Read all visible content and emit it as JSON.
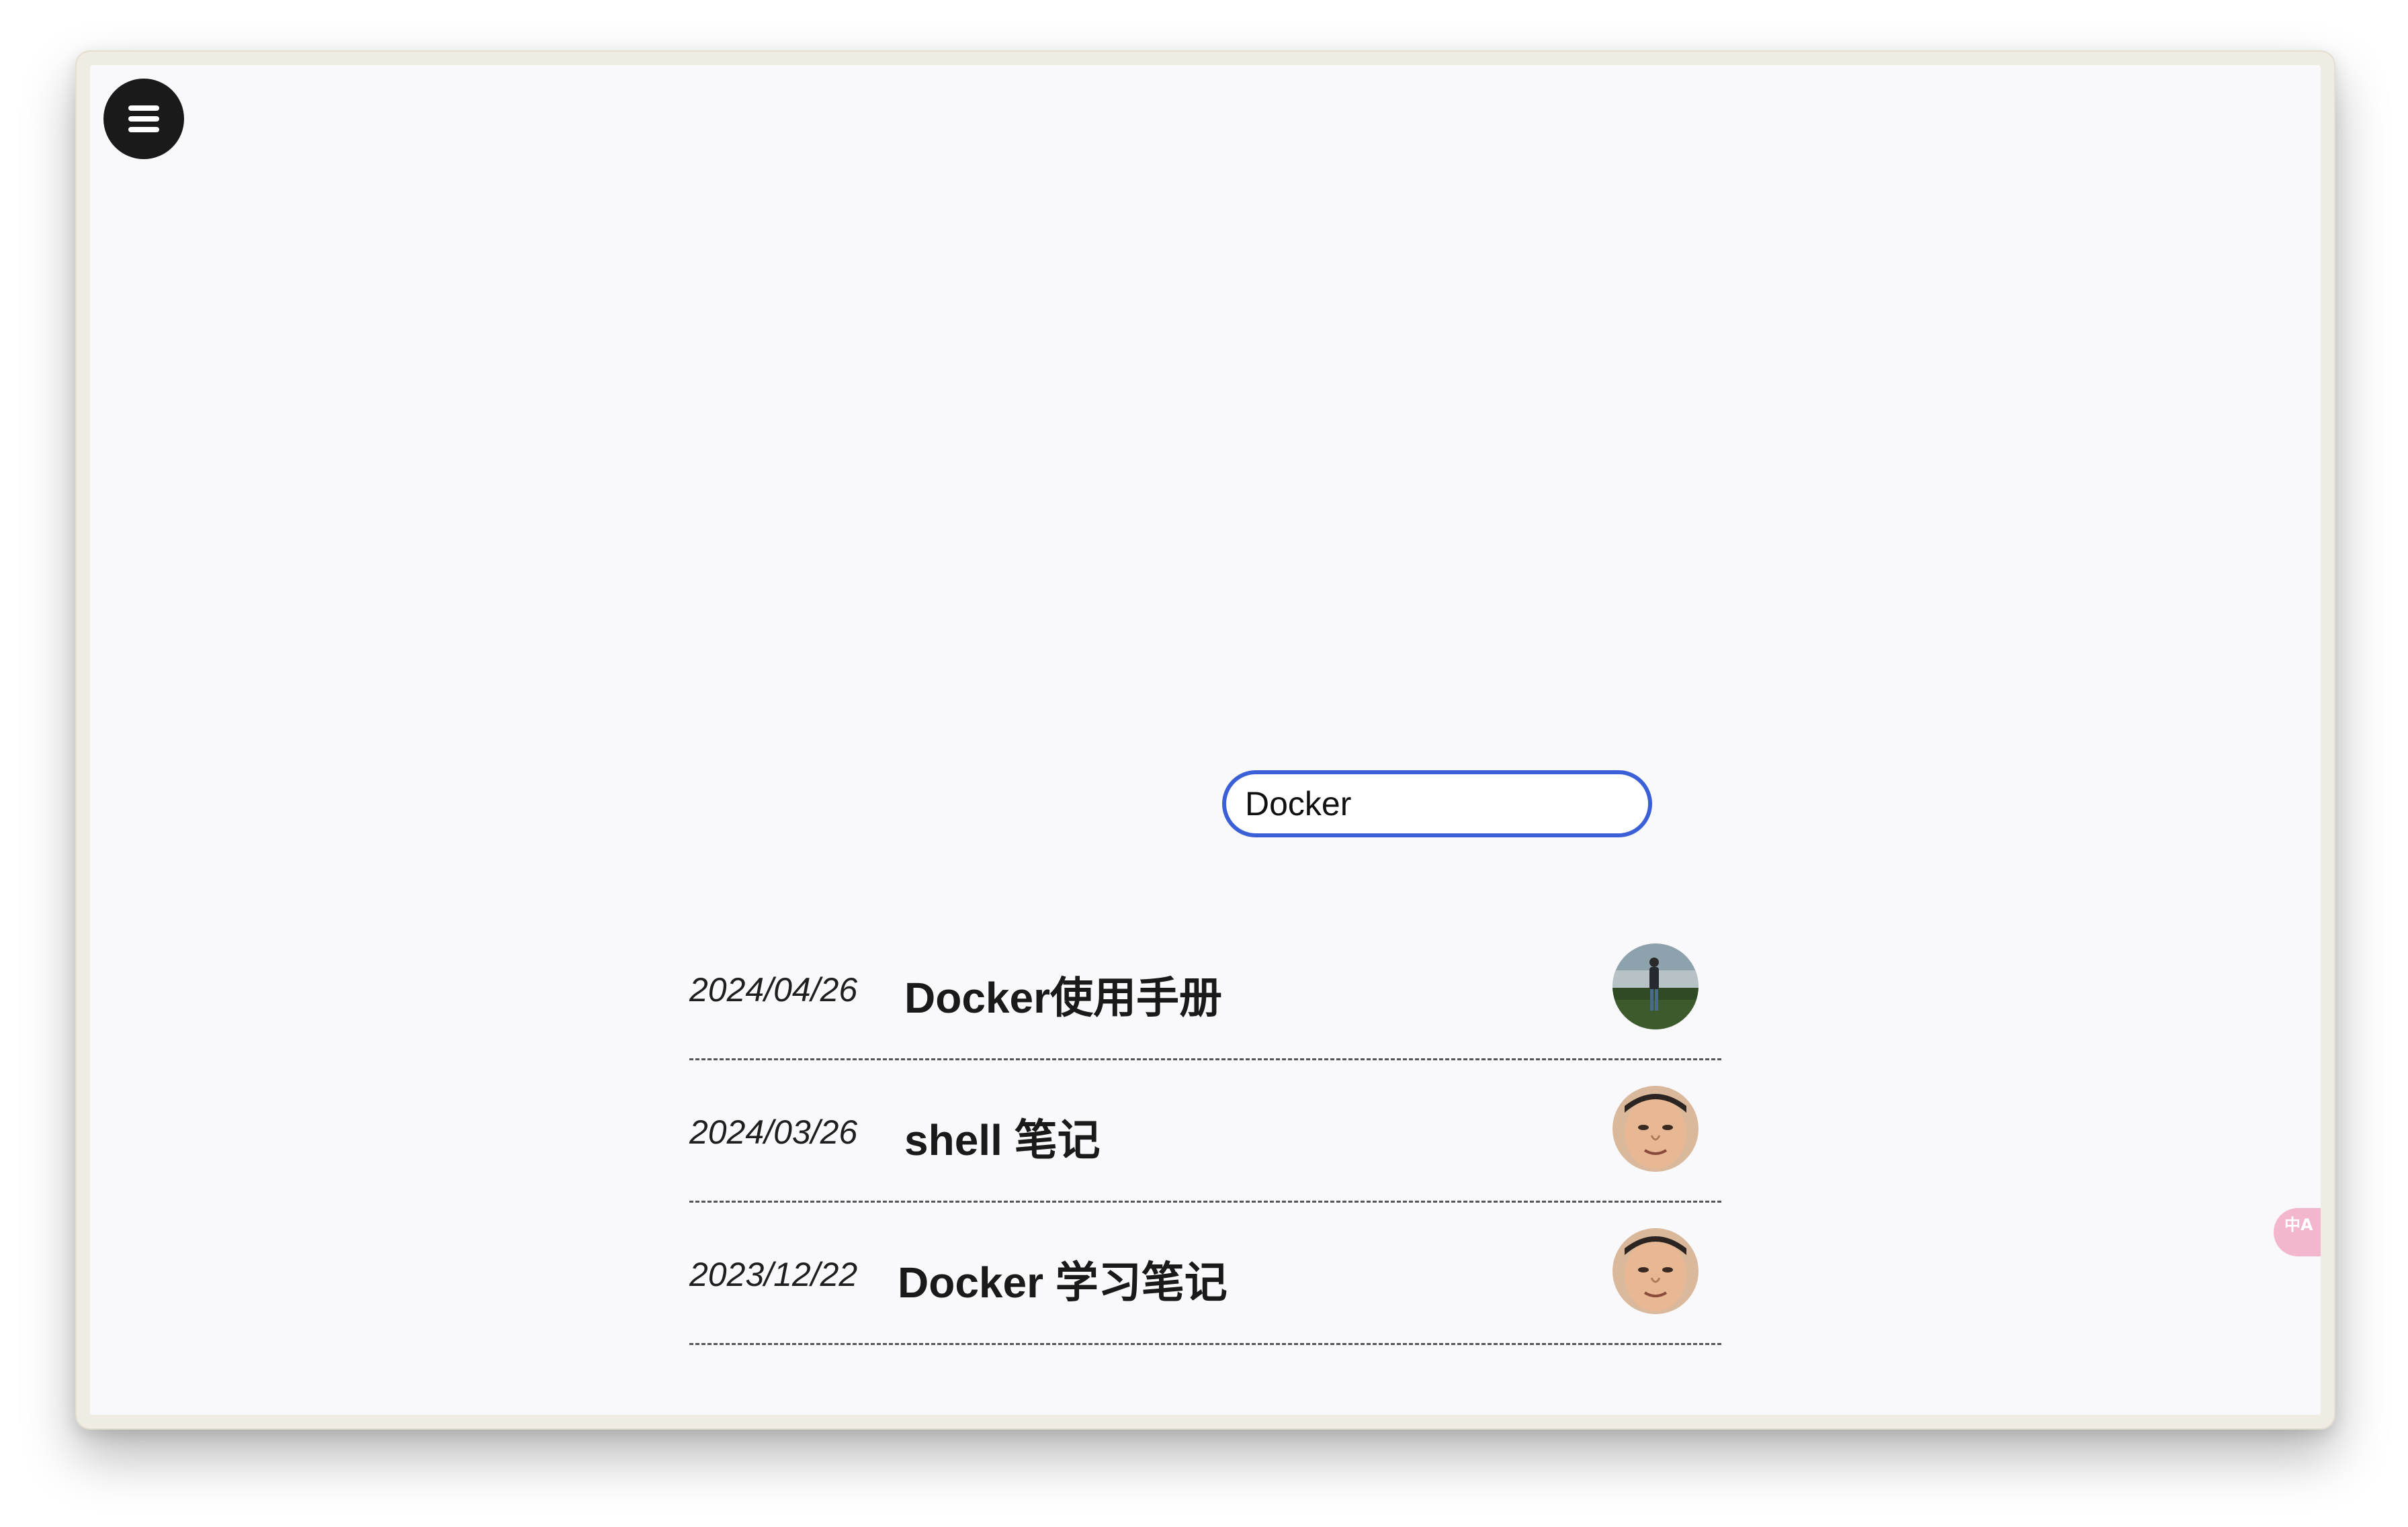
{
  "search": {
    "value": "Docker"
  },
  "posts": [
    {
      "date": "2024/04/26",
      "title": "Docker使用手册",
      "avatar": "person-landscape-avatar"
    },
    {
      "date": "2024/03/26",
      "title": "shell 笔记",
      "avatar": "face-avatar"
    },
    {
      "date": "2023/12/22",
      "title": "Docker 学习笔记",
      "avatar": "face-avatar"
    }
  ],
  "translate": {
    "icon": "translate-icon",
    "glyph": "中A"
  },
  "menu": {
    "icon": "hamburger-menu-icon"
  },
  "colors": {
    "search_border": "#3a5fd6",
    "background": "#f9f9fb",
    "menu_bg": "#1a1a1a",
    "translate_bg": "#f3b6cf"
  }
}
